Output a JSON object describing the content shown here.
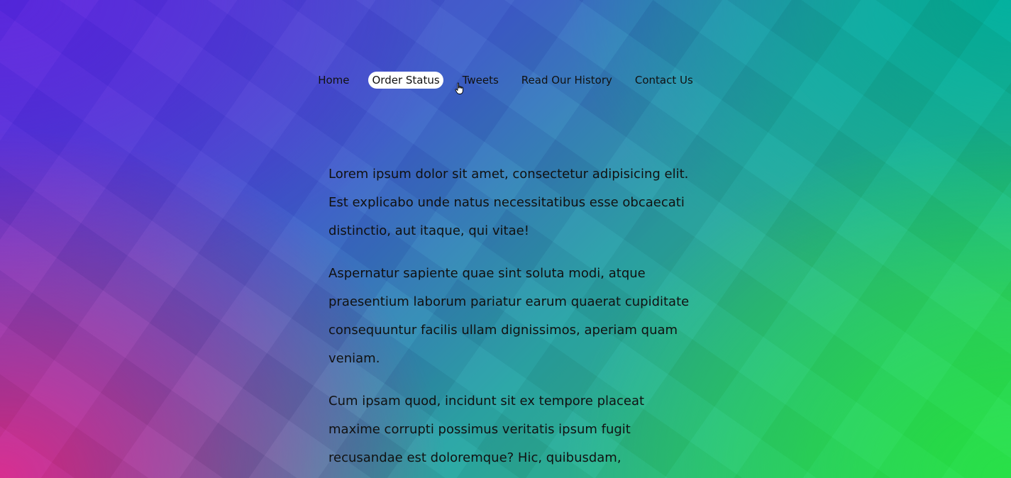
{
  "nav": {
    "items": [
      {
        "label": "Home",
        "active": false
      },
      {
        "label": "Order Status",
        "active": true
      },
      {
        "label": "Tweets",
        "active": false
      },
      {
        "label": "Read Our History",
        "active": false
      },
      {
        "label": "Contact Us",
        "active": false
      }
    ]
  },
  "content": {
    "paragraphs": [
      "Lorem ipsum dolor sit amet, consectetur adipisicing elit. Est explicabo unde natus necessitatibus esse obcaecati distinctio, aut itaque, qui vitae!",
      "Aspernatur sapiente quae sint soluta modi, atque praesentium laborum pariatur earum quaerat cupiditate consequuntur facilis ullam dignissimos, aperiam quam veniam.",
      "Cum ipsam quod, incidunt sit ex tempore placeat maxime corrupti possimus veritatis ipsum fugit recusandae est doloremque? Hic, quibusdam,"
    ]
  },
  "icons": {
    "cursor": "hand-pointer-icon"
  }
}
